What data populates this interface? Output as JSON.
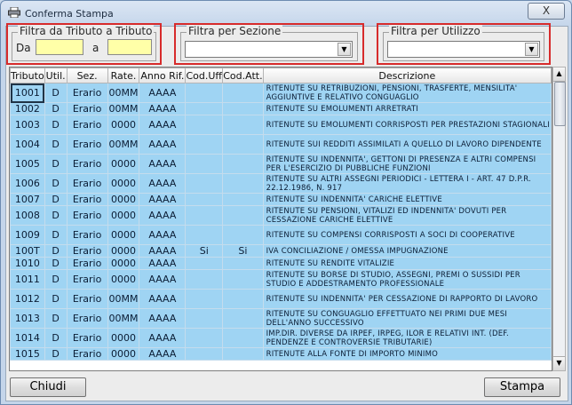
{
  "window": {
    "title": "Conferma Stampa",
    "close_symbol": "X"
  },
  "filters": {
    "tributo": {
      "legend": "Filtra da Tributo a Tributo",
      "from_label": "Da",
      "to_label": "a",
      "from_value": "",
      "to_value": ""
    },
    "sezione": {
      "legend": "Filtra per Sezione",
      "value": ""
    },
    "utilizzo": {
      "legend": "Filtra per Utilizzo",
      "value": ""
    },
    "highlight_color": "#d72b2b"
  },
  "table": {
    "columns": [
      "Tributo",
      "Util.",
      "Sez.",
      "Rate.",
      "Anno Rif.",
      "Cod.Uff",
      "Cod.Att.",
      "Descrizione"
    ],
    "rows": [
      [
        "1001",
        "D",
        "Erario",
        "00MM",
        "AAAA",
        "",
        "",
        "RITENUTE SU RETRIBUZIONI, PENSIONI, TRASFERTE, MENSILITA' AGGIUNTIVE E RELATIVO CONGUAGLIO"
      ],
      [
        "1002",
        "D",
        "Erario",
        "00MM",
        "AAAA",
        "",
        "",
        "RITENUTE SU EMOLUMENTI ARRETRATI"
      ],
      [
        "1003",
        "D",
        "Erario",
        "0000",
        "AAAA",
        "",
        "",
        "RITENUTE SU EMOLUMENTI CORRISPOSTI PER PRESTAZIONI STAGIONALI"
      ],
      [
        "1004",
        "D",
        "Erario",
        "00MM",
        "AAAA",
        "",
        "",
        "RITENUTE SUI REDDITI ASSIMILATI A QUELLO DI LAVORO DIPENDENTE"
      ],
      [
        "1005",
        "D",
        "Erario",
        "0000",
        "AAAA",
        "",
        "",
        "RITENUTE SU INDENNITA', GETTONI DI PRESENZA E ALTRI COMPENSI PER L'ESERCIZIO DI PUBBLICHE FUNZIONI"
      ],
      [
        "1006",
        "D",
        "Erario",
        "0000",
        "AAAA",
        "",
        "",
        "RITENUTE SU ALTRI ASSEGNI PERIODICI - LETTERA I - ART. 47 D.P.R. 22.12.1986, N. 917"
      ],
      [
        "1007",
        "D",
        "Erario",
        "0000",
        "AAAA",
        "",
        "",
        "RITENUTE SU INDENNITA' CARICHE ELETTIVE"
      ],
      [
        "1008",
        "D",
        "Erario",
        "0000",
        "AAAA",
        "",
        "",
        "RITENUTE SU PENSIONI, VITALIZI ED INDENNITA' DOVUTI PER CESSAZIONE CARICHE ELETTIVE"
      ],
      [
        "1009",
        "D",
        "Erario",
        "0000",
        "AAAA",
        "",
        "",
        "RITENUTE SU COMPENSI CORRISPOSTI A SOCI DI COOPERATIVE"
      ],
      [
        "100T",
        "D",
        "Erario",
        "0000",
        "AAAA",
        "Si",
        "Si",
        "IVA CONCILIAZIONE / OMESSA IMPUGNAZIONE"
      ],
      [
        "1010",
        "D",
        "Erario",
        "0000",
        "AAAA",
        "",
        "",
        "RITENUTE SU RENDITE VITALIZIE"
      ],
      [
        "1011",
        "D",
        "Erario",
        "0000",
        "AAAA",
        "",
        "",
        "RITENUTE SU BORSE DI STUDIO, ASSEGNI, PREMI O SUSSIDI PER STUDIO E ADDESTRAMENTO PROFESSIONALE"
      ],
      [
        "1012",
        "D",
        "Erario",
        "00MM",
        "AAAA",
        "",
        "",
        "RITENUTE SU INDENNITA' PER CESSAZIONE DI RAPPORTO DI LAVORO"
      ],
      [
        "1013",
        "D",
        "Erario",
        "00MM",
        "AAAA",
        "",
        "",
        "RITENUTE SU CONGUAGLIO EFFETTUATO NEI PRIMI DUE MESI DELL'ANNO SUCCESSIVO"
      ],
      [
        "1014",
        "D",
        "Erario",
        "0000",
        "AAAA",
        "",
        "",
        "IMP.DIR. DIVERSE DA IRPEF, IRPEG, ILOR E RELATIVI INT. (DEF. PENDENZE E CONTROVERSIE TRIBUTARIE)"
      ],
      [
        "1015",
        "D",
        "Erario",
        "0000",
        "AAAA",
        "",
        "",
        "RITENUTE ALLA FONTE DI IMPORTO MINIMO"
      ]
    ],
    "row_color": "#9fd4f3"
  },
  "buttons": {
    "close_label": "Chiudi",
    "print_label": "Stampa"
  },
  "icons": {
    "window": "printer-icon",
    "close": "close-icon",
    "dropdown": "chevron-down-icon",
    "scroll_up": "scroll-up-icon",
    "scroll_down": "scroll-down-icon"
  }
}
